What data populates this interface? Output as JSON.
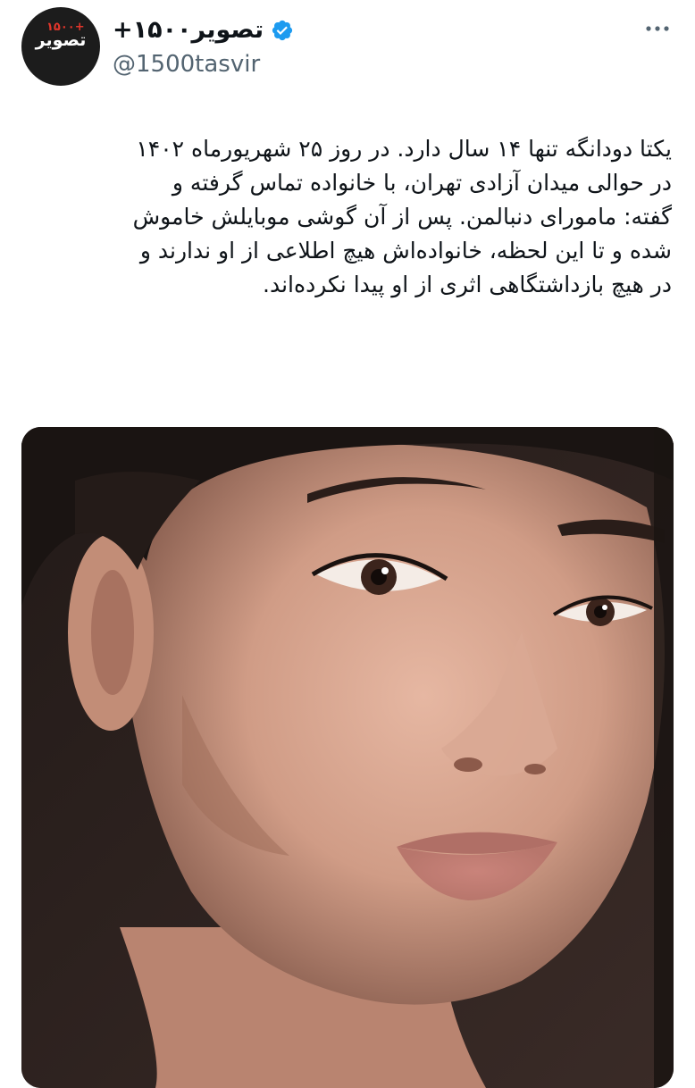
{
  "tweet": {
    "author": {
      "display_name": "+۱۵۰۰تصویر",
      "handle": "@1500tasvir",
      "verified": true,
      "avatar_logo_text": "تصویر",
      "avatar_logo_plus": "+۱۵۰۰"
    },
    "text_lines": [
      "یکتا دودانگه تنها ۱۴ سال دارد. در روز ۲۵ شهریورماه ۱۴۰۲",
      "در حوالی میدان آزادی تهران، با خانواده تماس گرفته و",
      "گفته: ماموراﻯ دنبالمن. پس از آن گوشی موبایلش خاموش",
      "شده و تا این لحظه، خانواده‌اش هیچ اطلاعی از او ندارند و",
      "در هیچ بازداشتگاهی اثری از او پیدا نکرده‌اند."
    ],
    "media": {
      "type": "photo",
      "description_icon": "portrait-photo"
    }
  },
  "colors": {
    "text_primary": "#0f1419",
    "text_secondary": "#536471",
    "verified_blue": "#1d9bf0",
    "avatar_bg": "#1c1c1c",
    "avatar_accent": "#e2362b"
  },
  "icons": {
    "verified": "verified-badge-icon",
    "more": "more-options-icon"
  }
}
